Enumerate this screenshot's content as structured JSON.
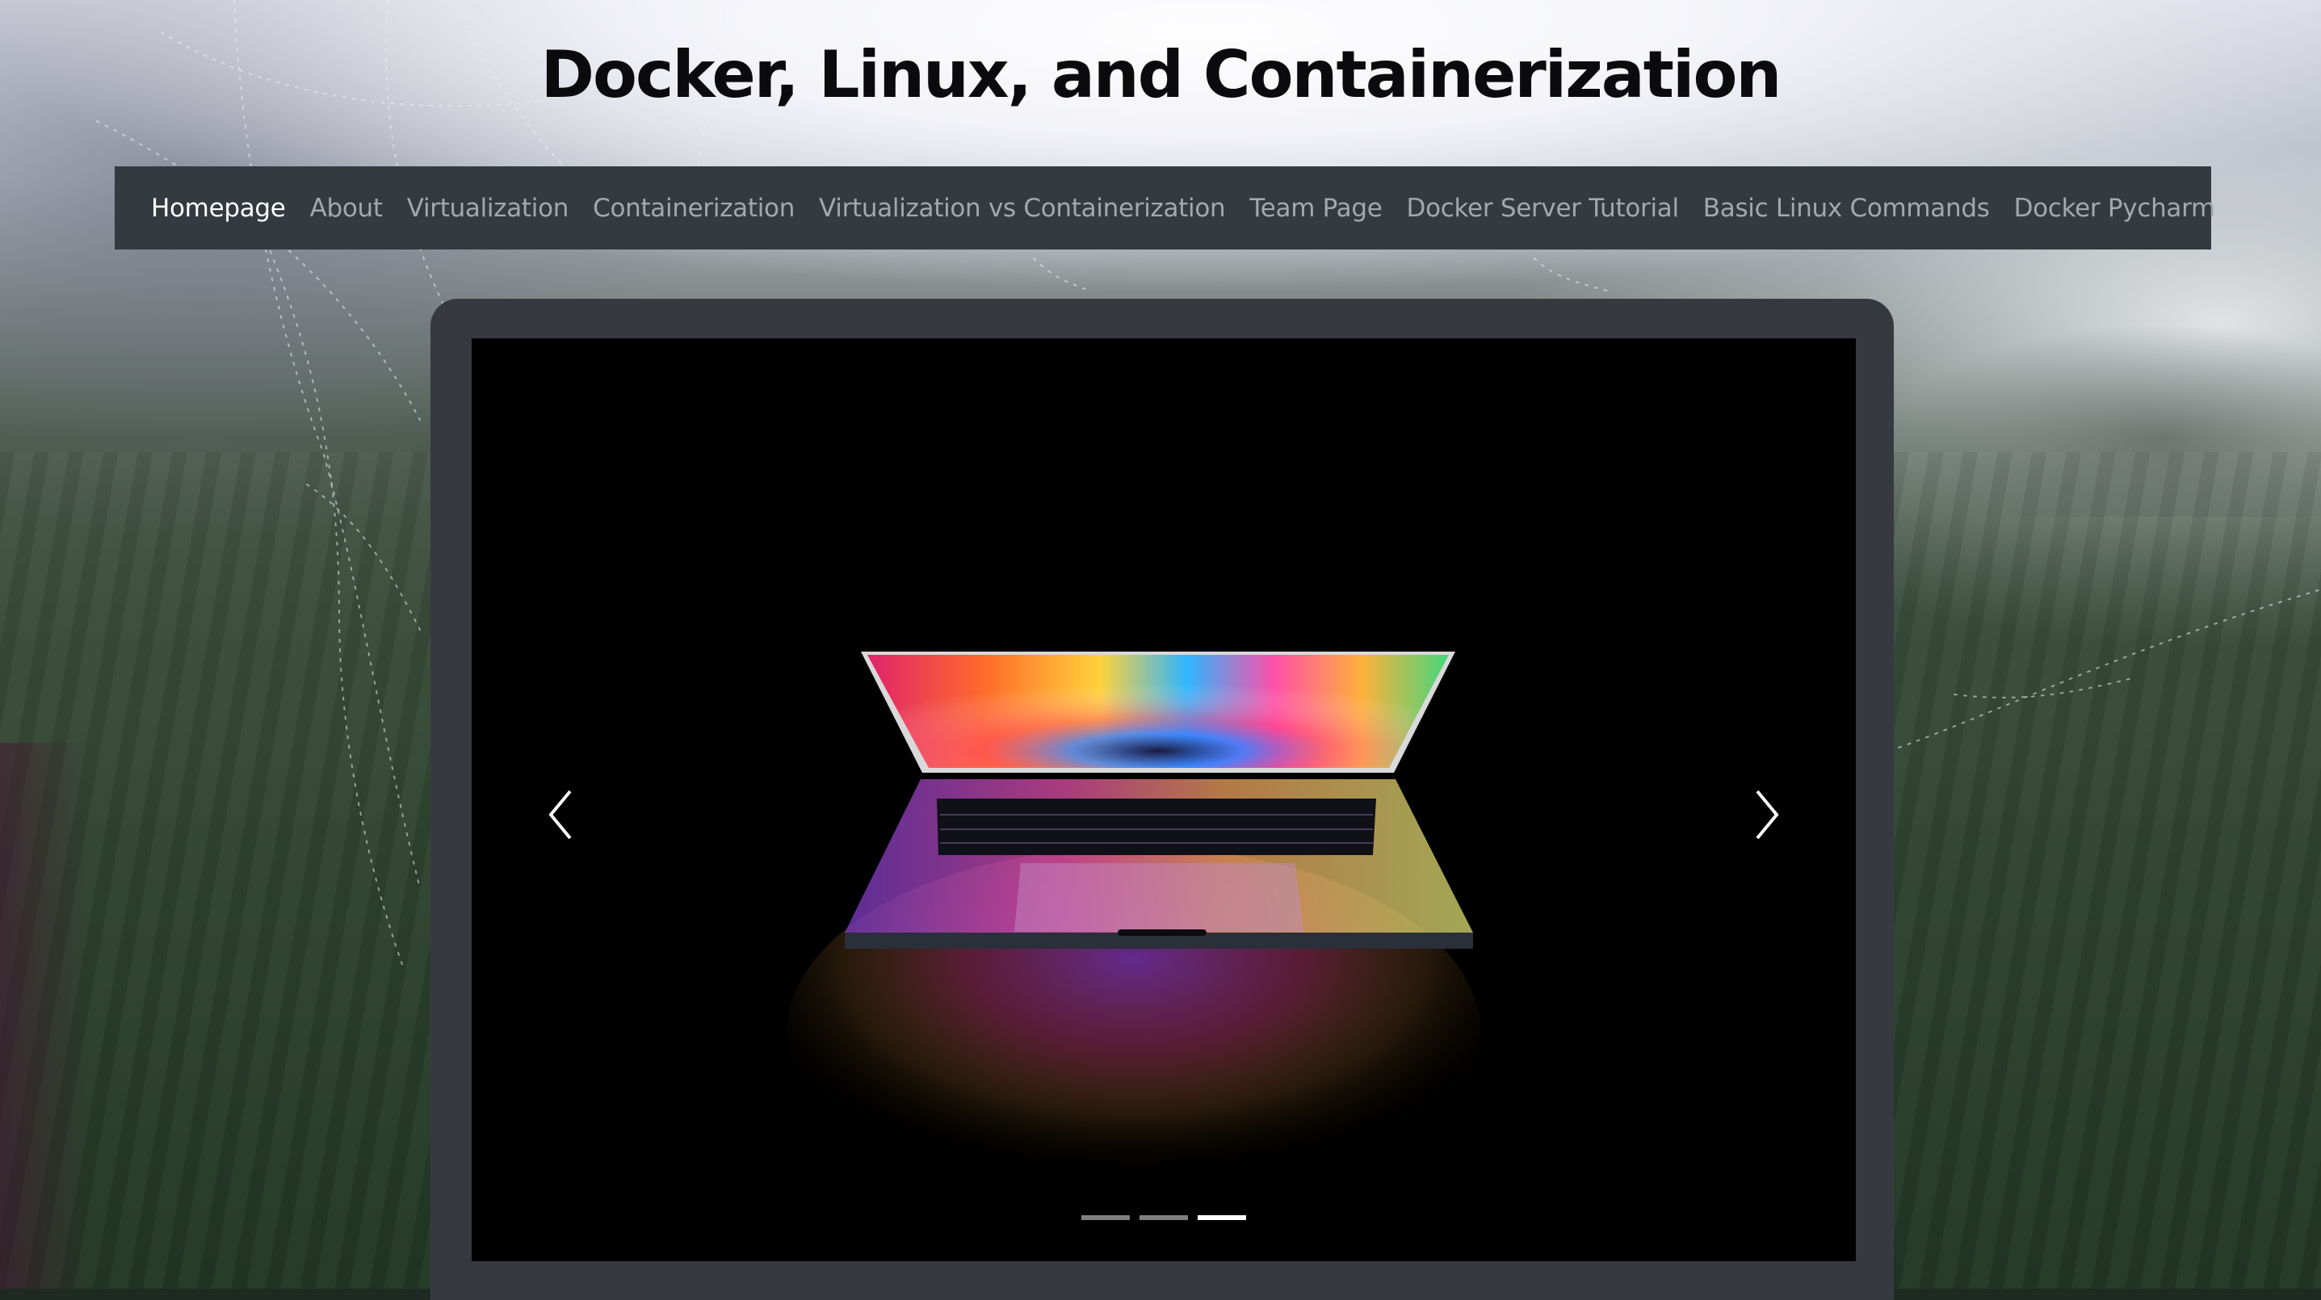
{
  "header": {
    "title": "Docker, Linux, and Containerization"
  },
  "nav": {
    "items": [
      {
        "label": "Homepage",
        "active": true
      },
      {
        "label": "About",
        "active": false
      },
      {
        "label": "Virtualization",
        "active": false
      },
      {
        "label": "Containerization",
        "active": false
      },
      {
        "label": "Virtualization vs Containerization",
        "active": false
      },
      {
        "label": "Team Page",
        "active": false
      },
      {
        "label": "Docker Server Tutorial",
        "active": false
      },
      {
        "label": "Basic Linux Commands",
        "active": false
      },
      {
        "label": "Docker Pycharm",
        "active": false
      }
    ]
  },
  "carousel": {
    "slide_count": 3,
    "active_slide": 3,
    "prev_icon": "chevron-left-icon",
    "next_icon": "chevron-right-icon"
  },
  "colors": {
    "navbar_bg": "#353a40",
    "nav_link": "#a3a8ad",
    "nav_link_active": "#ffffff",
    "frame": "#363a40",
    "title": "#0b0b0d"
  }
}
